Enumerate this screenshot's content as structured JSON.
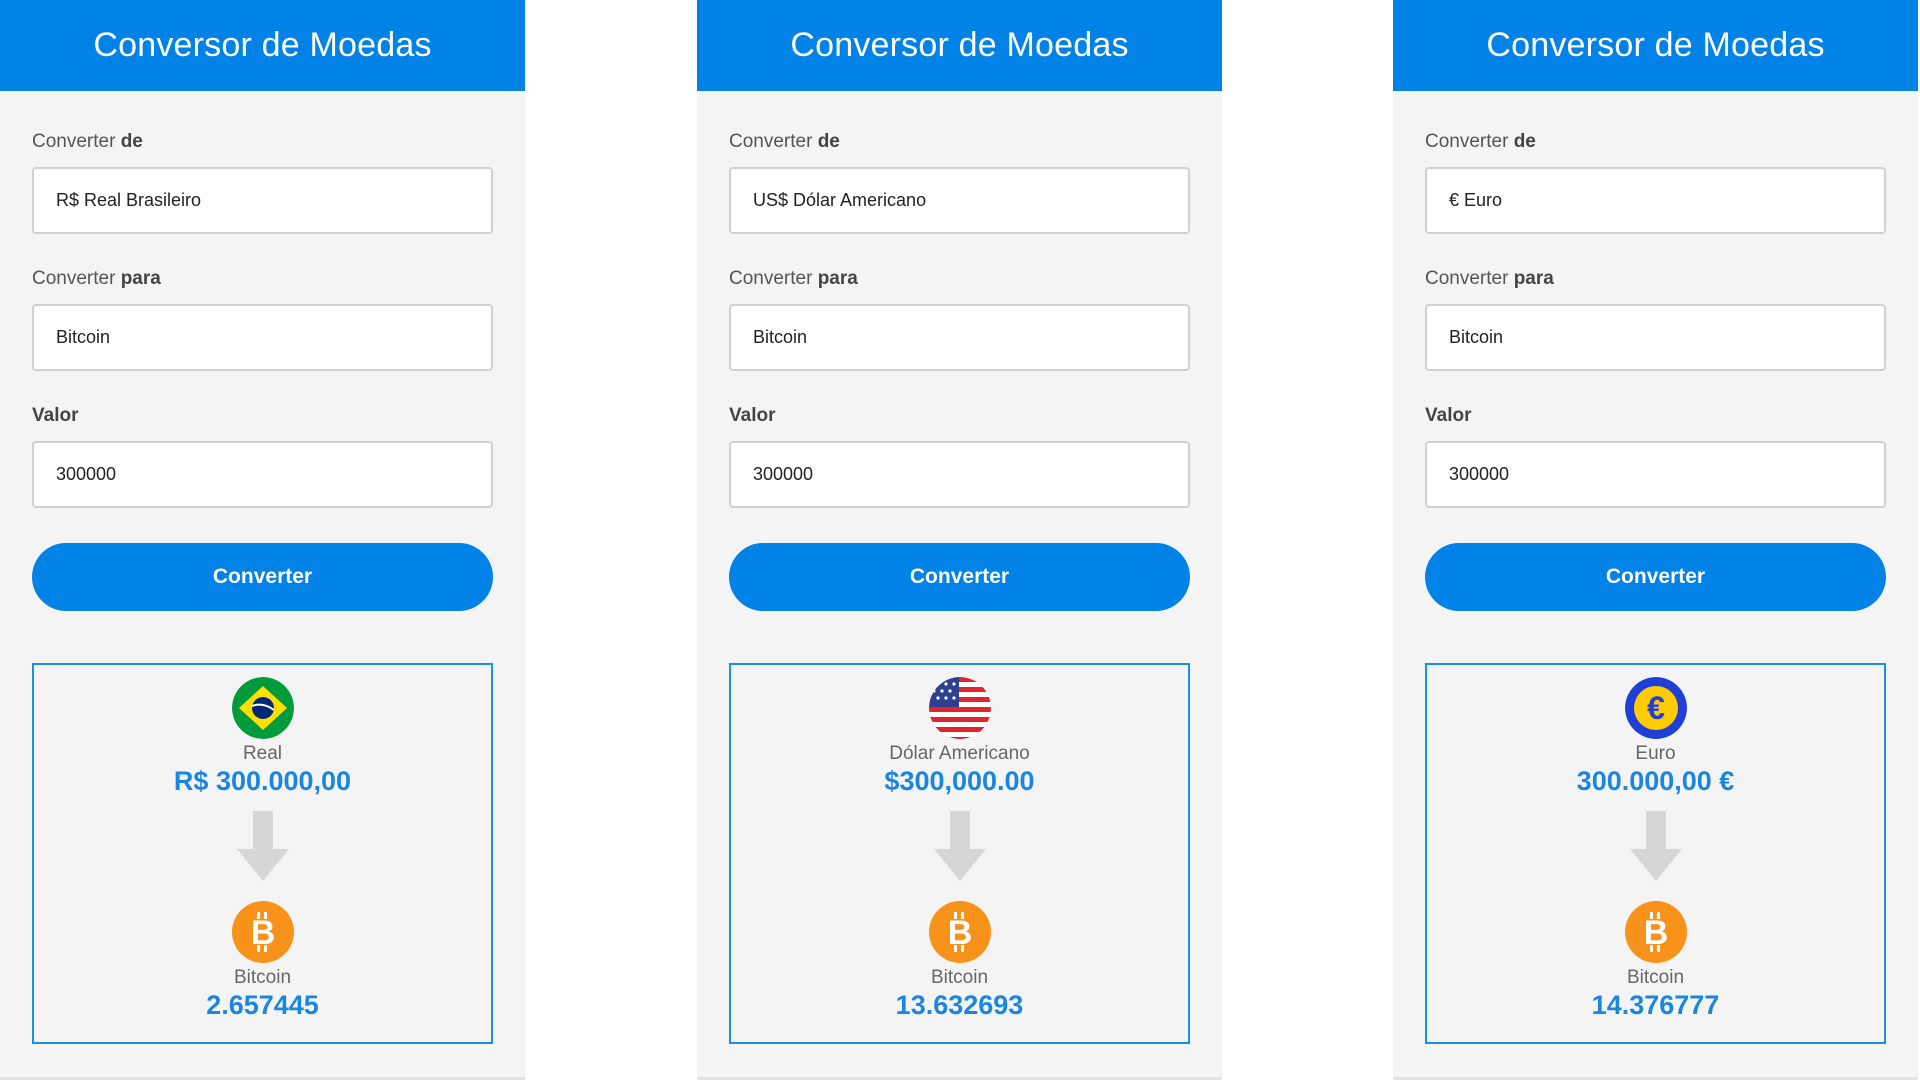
{
  "panels": [
    {
      "title": "Conversor de Moedas",
      "from_label": "Converter ",
      "from_label_strong": "de",
      "from_value": "R$ Real Brasileiro",
      "to_label": "Converter ",
      "to_label_strong": "para",
      "to_value": "Bitcoin",
      "amount_label": "Valor",
      "amount_value": "300000",
      "button_label": "Converter",
      "source_currency_name": "Real",
      "source_amount": "R$ 300.000,00",
      "source_flag_icon": "brazil-flag-icon",
      "target_currency_name": "Bitcoin",
      "target_amount": "2.657445"
    },
    {
      "title": "Conversor de Moedas",
      "from_label": "Converter ",
      "from_label_strong": "de",
      "from_value": "US$ Dólar Americano",
      "to_label": "Converter ",
      "to_label_strong": "para",
      "to_value": "Bitcoin",
      "amount_label": "Valor",
      "amount_value": "300000",
      "button_label": "Converter",
      "source_currency_name": "Dólar Americano",
      "source_amount": "$300,000.00",
      "source_flag_icon": "usa-flag-icon",
      "target_currency_name": "Bitcoin",
      "target_amount": "13.632693"
    },
    {
      "title": "Conversor de Moedas",
      "from_label": "Converter ",
      "from_label_strong": "de",
      "from_value": "€ Euro",
      "to_label": "Converter ",
      "to_label_strong": "para",
      "to_value": "Bitcoin",
      "amount_label": "Valor",
      "amount_value": "300000",
      "button_label": "Converter",
      "source_currency_name": "Euro",
      "source_amount": "300.000,00 €",
      "source_flag_icon": "euro-icon",
      "target_currency_name": "Bitcoin",
      "target_amount": "14.376777"
    }
  ],
  "colors": {
    "brand_blue": "#0082e6",
    "amount_blue": "#1a86e0",
    "panel_bg": "#f4f4f4",
    "bitcoin_orange": "#f7931a"
  }
}
